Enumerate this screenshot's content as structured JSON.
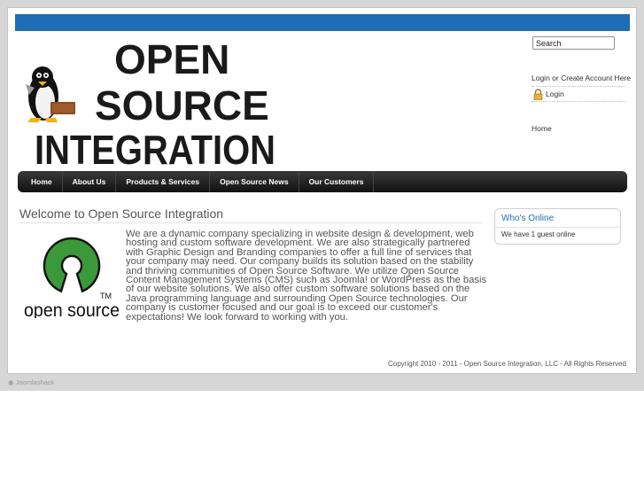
{
  "header": {
    "brand": "Open Source Integration",
    "logo_words": [
      "OPEN",
      "SOURCE",
      "INTEGRATION"
    ]
  },
  "search": {
    "value": "Search"
  },
  "account": {
    "login_create_text": "Login or Create Account Here",
    "login_label": "Login",
    "home_label": "Home"
  },
  "nav": {
    "items": [
      {
        "label": "Home"
      },
      {
        "label": "About Us"
      },
      {
        "label": "Products & Services"
      },
      {
        "label": "Open Source News"
      },
      {
        "label": "Our Customers"
      }
    ]
  },
  "main": {
    "title": "Welcome to Open Source Integration",
    "logo_text": "open source",
    "logo_tm": "TM",
    "body": "We are a dynamic company specializing in website design & development, web hosting and custom software development.  We are also strategically partnered with Graphic Design and Branding companies to offer a full line of services that your company may need.  Our company builds its solution based on the stability and thriving communities of Open Source Software.  We utilize Open Source Content Management Systems (CMS) such as Joomla! or WordPress as the basis of our website solutions.  We also offer custom software solutions based on the Java programming language and surrounding Open Source technologies.  Our company is customer focused and our goal is to exceed our customer's expectations!  We look forward to working with you."
  },
  "sidebar": {
    "whos_online_title": "Who's Online",
    "whos_online_text": "We have 1 guest online"
  },
  "footer": {
    "copyright": "Copyright 2010 - 2011 - Open Source Integration,  LLC - All Rights Reserved",
    "credit": "Joomlashack"
  },
  "colors": {
    "topbar": "#1e6db5",
    "nav": "#1a1a1a",
    "accent_link": "#2a6fb3",
    "osi_green": "#3a9a3a"
  }
}
